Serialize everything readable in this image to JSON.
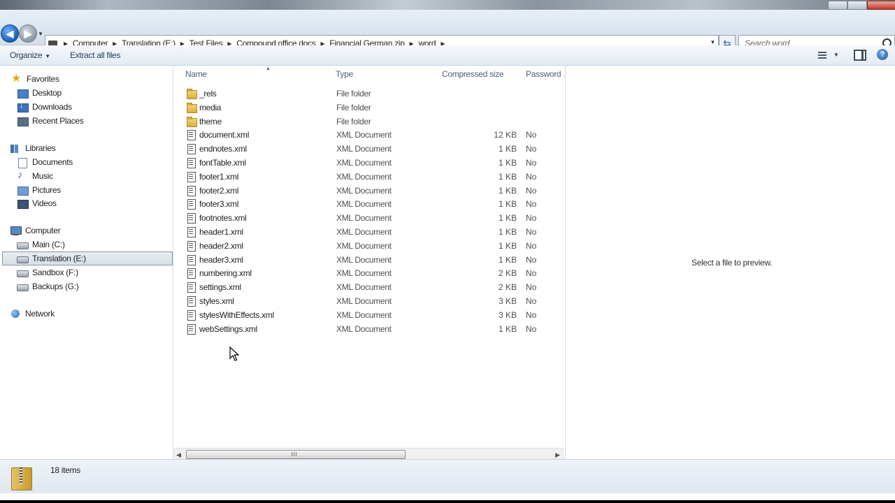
{
  "address": {
    "crumbs": [
      "Computer",
      "Translation (E:)",
      "Test Files",
      "Compound office docs",
      "Financial German.zip",
      "word"
    ]
  },
  "search": {
    "placeholder": "Search word"
  },
  "toolbar": {
    "organize": "Organize",
    "extract_all": "Extract all files"
  },
  "nav": {
    "favorites": "Favorites",
    "desktop": "Desktop",
    "downloads": "Downloads",
    "recent": "Recent Places",
    "libraries": "Libraries",
    "documents": "Documents",
    "music": "Music",
    "pictures": "Pictures",
    "videos": "Videos",
    "computer": "Computer",
    "main": "Main (C:)",
    "translation": "Translation (E:)",
    "sandbox": "Sandbox (F:)",
    "backups": "Backups (G:)",
    "network": "Network"
  },
  "columns": {
    "name": "Name",
    "type": "Type",
    "size": "Compressed size",
    "password": "Password ..."
  },
  "files": [
    {
      "name": "_rels",
      "type": "File folder",
      "size": "",
      "password": "",
      "icon": "folder-icon"
    },
    {
      "name": "media",
      "type": "File folder",
      "size": "",
      "password": "",
      "icon": "folder-icon"
    },
    {
      "name": "theme",
      "type": "File folder",
      "size": "",
      "password": "",
      "icon": "folder-icon"
    },
    {
      "name": "document.xml",
      "type": "XML Document",
      "size": "12 KB",
      "password": "No",
      "icon": "xml-file-icon"
    },
    {
      "name": "endnotes.xml",
      "type": "XML Document",
      "size": "1 KB",
      "password": "No",
      "icon": "xml-file-icon"
    },
    {
      "name": "fontTable.xml",
      "type": "XML Document",
      "size": "1 KB",
      "password": "No",
      "icon": "xml-file-icon"
    },
    {
      "name": "footer1.xml",
      "type": "XML Document",
      "size": "1 KB",
      "password": "No",
      "icon": "xml-file-icon"
    },
    {
      "name": "footer2.xml",
      "type": "XML Document",
      "size": "1 KB",
      "password": "No",
      "icon": "xml-file-icon"
    },
    {
      "name": "footer3.xml",
      "type": "XML Document",
      "size": "1 KB",
      "password": "No",
      "icon": "xml-file-icon"
    },
    {
      "name": "footnotes.xml",
      "type": "XML Document",
      "size": "1 KB",
      "password": "No",
      "icon": "xml-file-icon"
    },
    {
      "name": "header1.xml",
      "type": "XML Document",
      "size": "1 KB",
      "password": "No",
      "icon": "xml-file-icon"
    },
    {
      "name": "header2.xml",
      "type": "XML Document",
      "size": "1 KB",
      "password": "No",
      "icon": "xml-file-icon"
    },
    {
      "name": "header3.xml",
      "type": "XML Document",
      "size": "1 KB",
      "password": "No",
      "icon": "xml-file-icon"
    },
    {
      "name": "numbering.xml",
      "type": "XML Document",
      "size": "2 KB",
      "password": "No",
      "icon": "xml-file-icon"
    },
    {
      "name": "settings.xml",
      "type": "XML Document",
      "size": "2 KB",
      "password": "No",
      "icon": "xml-file-icon"
    },
    {
      "name": "styles.xml",
      "type": "XML Document",
      "size": "3 KB",
      "password": "No",
      "icon": "xml-file-icon"
    },
    {
      "name": "stylesWithEffects.xml",
      "type": "XML Document",
      "size": "3 KB",
      "password": "No",
      "icon": "xml-file-icon"
    },
    {
      "name": "webSettings.xml",
      "type": "XML Document",
      "size": "1 KB",
      "password": "No",
      "icon": "xml-file-icon"
    }
  ],
  "preview": {
    "message": "Select a file to preview."
  },
  "status": {
    "count": "18 items"
  },
  "colors": {
    "accent": "#1c5fb4",
    "header_text": "#4c607a",
    "folder": "#d9ad3c"
  }
}
